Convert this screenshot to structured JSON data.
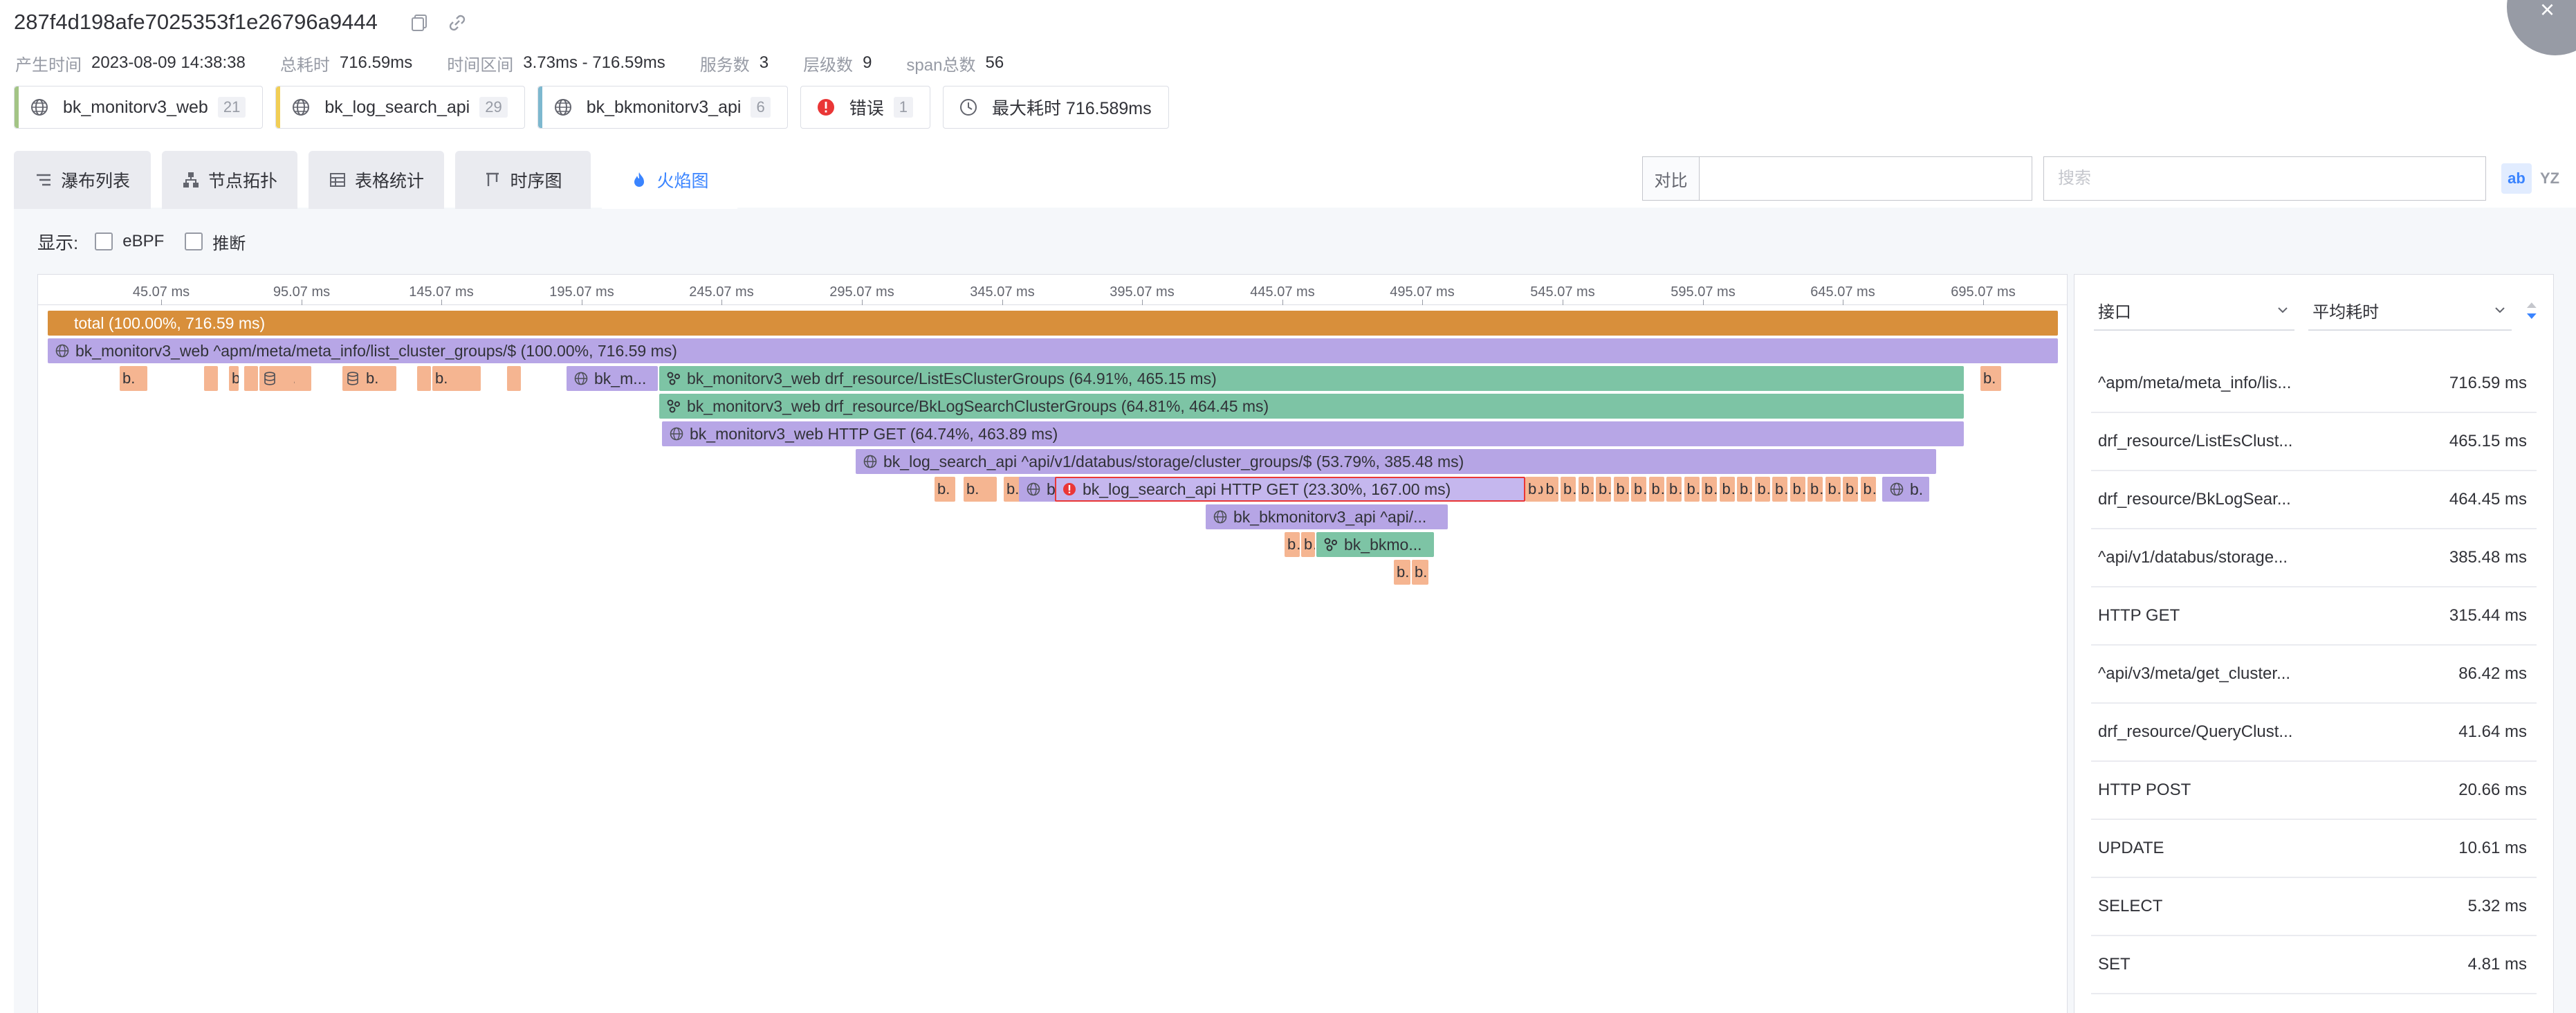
{
  "header": {
    "trace_id": "287f4d198afe7025353f1e26796a9444",
    "close_label": "×"
  },
  "meta": [
    {
      "label": "产生时间",
      "value": "2023-08-09 14:38:38"
    },
    {
      "label": "总耗时",
      "value": "716.59ms"
    },
    {
      "label": "时间区间",
      "value": "3.73ms - 716.59ms"
    },
    {
      "label": "服务数",
      "value": "3"
    },
    {
      "label": "层级数",
      "value": "9"
    },
    {
      "label": "span总数",
      "value": "56"
    }
  ],
  "service_tags": [
    {
      "name": "bk_monitorv3_web",
      "count": "21",
      "color": "#a3c485",
      "icon": "globe-icon"
    },
    {
      "name": "bk_log_search_api",
      "count": "29",
      "color": "#f1ce55",
      "icon": "globe-icon"
    },
    {
      "name": "bk_bkmonitorv3_api",
      "count": "6",
      "color": "#7db8cf",
      "icon": "globe-icon"
    },
    {
      "name": "错误",
      "count": "1",
      "color": "#ea3636",
      "icon": "error-icon"
    },
    {
      "name": "最大耗时 716.589ms",
      "count": "",
      "color": "",
      "icon": "clock-icon"
    }
  ],
  "tabs": [
    {
      "label": "瀑布列表",
      "icon": "waterfall-icon",
      "active": false
    },
    {
      "label": "节点拓扑",
      "icon": "topology-icon",
      "active": false
    },
    {
      "label": "表格统计",
      "icon": "table-icon",
      "active": false
    },
    {
      "label": "时序图",
      "icon": "sequence-icon",
      "active": false
    },
    {
      "label": "火焰图",
      "icon": "flame-icon",
      "active": true
    }
  ],
  "compare": {
    "label": "对比",
    "value": ""
  },
  "search": {
    "placeholder": "搜索",
    "value": ""
  },
  "tools": {
    "case_label": "ab",
    "regex_label": "YZ"
  },
  "display": {
    "label": "显示:",
    "options": [
      {
        "label": "eBPF",
        "checked": false
      },
      {
        "label": "推断",
        "checked": false
      }
    ]
  },
  "axis_ticks": [
    "45.07 ms",
    "95.07 ms",
    "145.07 ms",
    "195.07 ms",
    "245.07 ms",
    "295.07 ms",
    "345.07 ms",
    "395.07 ms",
    "445.07 ms",
    "495.07 ms",
    "545.07 ms",
    "595.07 ms",
    "645.07 ms",
    "695.07 ms"
  ],
  "colors": {
    "total": "#d88f3b",
    "web": "#b7a6e6",
    "web_light": "#c5b7ee",
    "drf": "#7dc4a5",
    "log": "#b6a5e5",
    "small": "#f5b591",
    "error_border": "#ea3636",
    "accent": "#3a84ff"
  },
  "flame_frames": [
    {
      "label": "total (100.00%, 716.59 ms)",
      "kind": "total",
      "icon": ""
    },
    {
      "label": "bk_monitorv3_web ^apm/meta/meta_info/list_cluster_groups/$ (100.00%, 716.59 ms)",
      "kind": "web",
      "icon": "globe-icon"
    },
    {
      "label": "b.",
      "kind": "small",
      "icon": ""
    },
    {
      "label": "b.",
      "kind": "small",
      "icon": ""
    },
    {
      "label": "b.",
      "kind": "small",
      "icon": "database-icon"
    },
    {
      "label": "b.",
      "kind": "small",
      "icon": "database-icon"
    },
    {
      "label": "b.",
      "kind": "small",
      "icon": ""
    },
    {
      "label": "b.",
      "kind": "small",
      "icon": "database-icon"
    },
    {
      "label": "bk_m...",
      "kind": "web",
      "icon": "globe-icon"
    },
    {
      "label": "bk_monitorv3_web drf_resource/ListEsClusterGroups (64.91%, 465.15 ms)",
      "kind": "drf",
      "icon": "cluster-icon"
    },
    {
      "label": "b.",
      "kind": "small",
      "icon": ""
    },
    {
      "label": "bk_monitorv3_web drf_resource/BkLogSearchClusterGroups (64.81%, 464.45 ms)",
      "kind": "drf",
      "icon": "cluster-icon"
    },
    {
      "label": "bk_monitorv3_web HTTP GET (64.74%, 463.89 ms)",
      "kind": "web",
      "icon": "globe-icon"
    },
    {
      "label": "bk_log_search_api ^api/v1/databus/storage/cluster_groups/$ (53.79%, 385.48 ms)",
      "kind": "log",
      "icon": "globe-icon"
    },
    {
      "label": "b.",
      "kind": "small",
      "icon": ""
    },
    {
      "label": "b.",
      "kind": "small",
      "icon": ""
    },
    {
      "label": "b.",
      "kind": "small",
      "icon": ""
    },
    {
      "label": "b.",
      "kind": "small",
      "icon": ""
    },
    {
      "label": "b",
      "kind": "log",
      "icon": "globe-icon"
    },
    {
      "label": "bk_log_search_api HTTP GET (23.30%, 167.00 ms)",
      "kind": "web_err",
      "icon": "error-icon"
    },
    {
      "label": "b.",
      "kind": "small",
      "icon": ""
    },
    {
      "label": "b.",
      "kind": "log",
      "icon": "globe-icon"
    },
    {
      "label": "bk_bkmonitorv3_api ^api/...",
      "kind": "log",
      "icon": "globe-icon"
    },
    {
      "label": "b.",
      "kind": "small",
      "icon": ""
    },
    {
      "label": "b.",
      "kind": "small",
      "icon": ""
    },
    {
      "label": "bk_bkmo...",
      "kind": "drf",
      "icon": "cluster-icon"
    },
    {
      "label": "b.",
      "kind": "small",
      "icon": ""
    },
    {
      "label": "b.",
      "kind": "small",
      "icon": ""
    }
  ],
  "side_panel": {
    "col_interface": "接口",
    "col_metric": "平均耗时",
    "rows": [
      {
        "name": "^apm/meta/meta_info/lis...",
        "value": "716.59 ms"
      },
      {
        "name": "drf_resource/ListEsClust...",
        "value": "465.15 ms"
      },
      {
        "name": "drf_resource/BkLogSear...",
        "value": "464.45 ms"
      },
      {
        "name": "^api/v1/databus/storage...",
        "value": "385.48 ms"
      },
      {
        "name": "HTTP GET",
        "value": "315.44 ms"
      },
      {
        "name": "^api/v3/meta/get_cluster...",
        "value": "86.42 ms"
      },
      {
        "name": "drf_resource/QueryClust...",
        "value": "41.64 ms"
      },
      {
        "name": "HTTP POST",
        "value": "20.66 ms"
      },
      {
        "name": "UPDATE",
        "value": "10.61 ms"
      },
      {
        "name": "SELECT",
        "value": "5.32 ms"
      },
      {
        "name": "SET",
        "value": "4.81 ms"
      }
    ]
  }
}
